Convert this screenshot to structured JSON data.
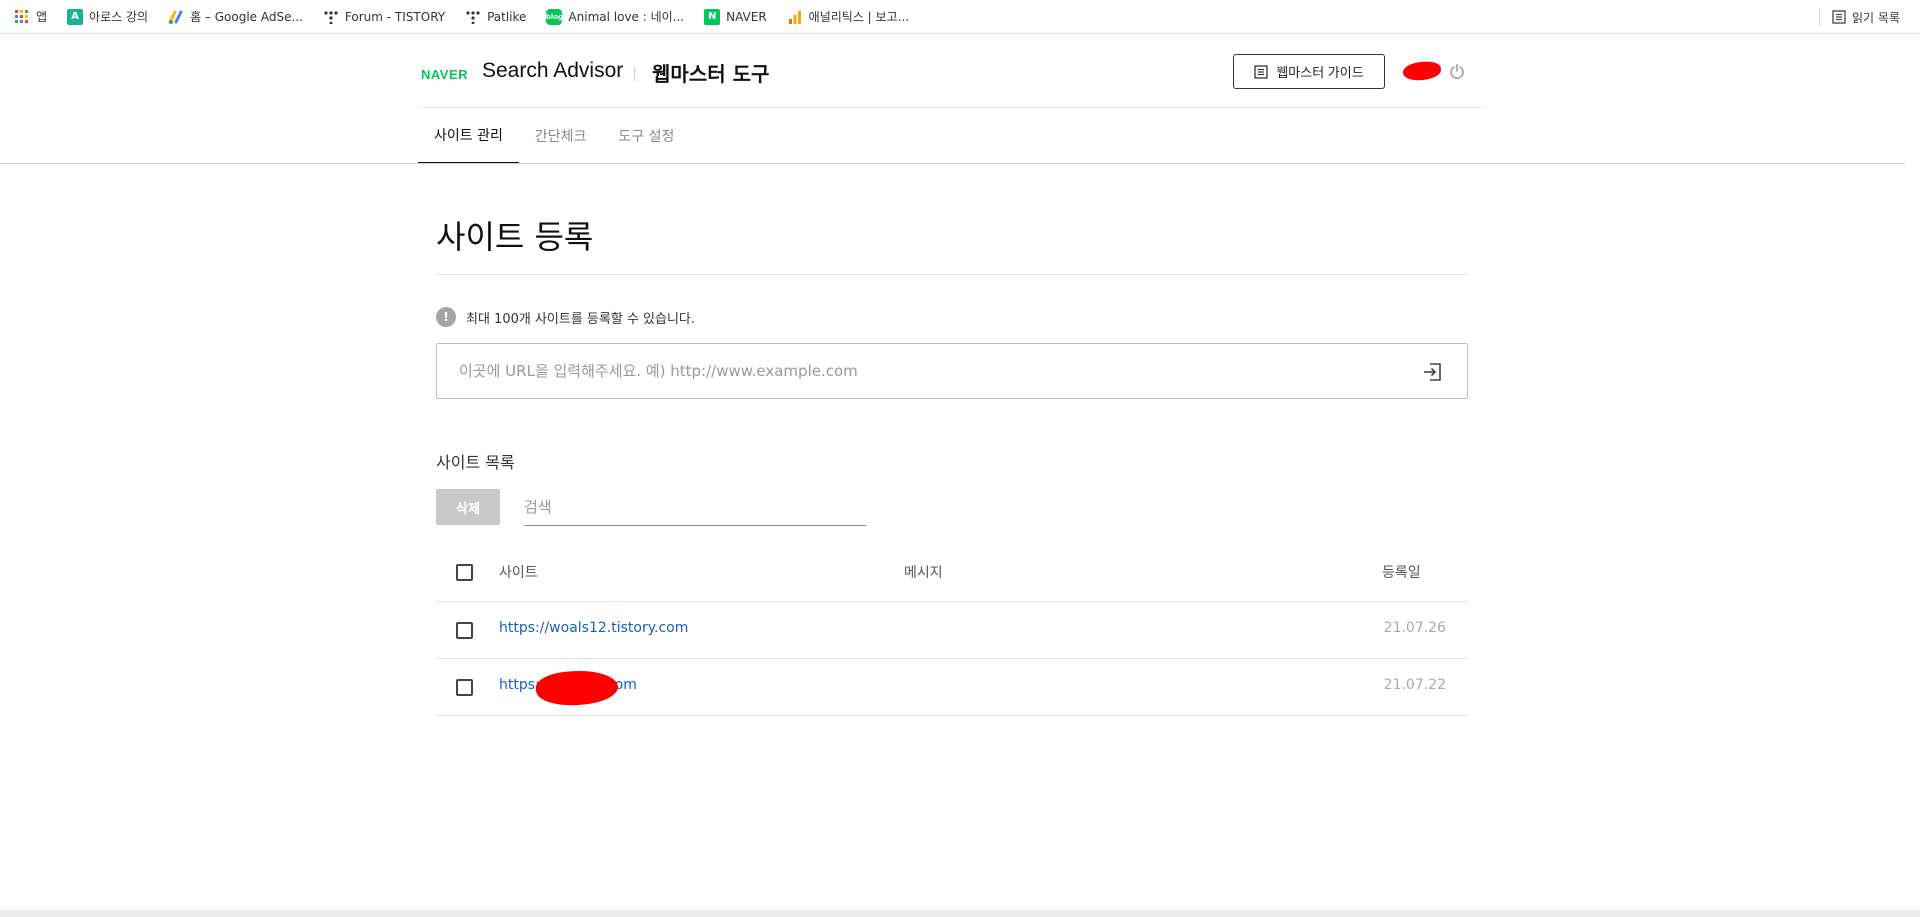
{
  "bookmarks": [
    {
      "label": "앱",
      "icon": "apps-grid-icon"
    },
    {
      "label": "아로스 강의",
      "icon": "a-icon"
    },
    {
      "label": "홈 – Google AdSe...",
      "icon": "adsense-icon"
    },
    {
      "label": "Forum - TISTORY",
      "icon": "tistory-icon"
    },
    {
      "label": "Patlike",
      "icon": "tistory-icon"
    },
    {
      "label": "Animal love : 네이...",
      "icon": "blog-icon"
    },
    {
      "label": "NAVER",
      "icon": "naver-icon"
    },
    {
      "label": "애널리틱스 | 보고...",
      "icon": "analytics-icon"
    }
  ],
  "reading_list": "읽기 목록",
  "header": {
    "naver": "NAVER",
    "search_advisor": "Search Advisor",
    "tool": "웹마스터 도구",
    "guide_button": "웹마스터 가이드"
  },
  "tabs": [
    {
      "label": "사이트 관리",
      "active": true
    },
    {
      "label": "간단체크",
      "active": false
    },
    {
      "label": "도구 설정",
      "active": false
    }
  ],
  "page_title": "사이트 등록",
  "notice": "최대 100개 사이트를 등록할 수 있습니다.",
  "url_input": {
    "placeholder": "이곳에 URL을 입력해주세요. 예) http://www.example.com",
    "value": ""
  },
  "site_list": {
    "title": "사이트 목록",
    "delete_button": "삭제",
    "search_placeholder": "검색",
    "columns": {
      "site": "사이트",
      "message": "메시지",
      "date": "등록일"
    },
    "rows": [
      {
        "site": "https://woals12.tistory.com",
        "message": "",
        "date": "21.07.26"
      },
      {
        "site": "https://            .com",
        "message": "",
        "date": "21.07.22"
      }
    ]
  },
  "colors": {
    "naver_green": "#03c75a",
    "link_blue": "#1a5fc2",
    "redaction": "#ff0000"
  }
}
